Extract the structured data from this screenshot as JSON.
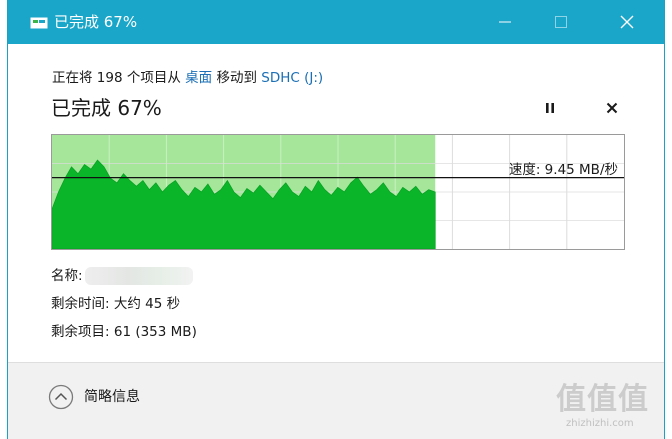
{
  "window": {
    "title": "已完成 67%",
    "accent_color": "#1aa6c9"
  },
  "transfer": {
    "line_prefix": "正在将 198 个项目从 ",
    "source": "桌面",
    "line_mid": " 移动到 ",
    "destination": "SDHC (J:)",
    "status": "已完成 67%",
    "progress_percent": 67,
    "speed_text": "速度: 9.45 MB/秒"
  },
  "details": {
    "name_label": "名称:",
    "time_label": "剩余时间:",
    "time_value": "大约 45 秒",
    "items_label": "剩余项目:",
    "items_value": "61 (353 MB)"
  },
  "footer": {
    "toggle_label": "简略信息"
  },
  "watermark": {
    "text": "值值值",
    "url": "zhizhizhi.com"
  },
  "icons": {
    "app": "transfer-icon",
    "minimize": "minimize-icon",
    "maximize": "maximize-icon",
    "close": "close-icon",
    "pause": "pause-icon",
    "cancel": "cancel-icon",
    "collapse": "chevron-up-icon"
  },
  "chart_data": {
    "type": "area",
    "progress_fraction": 0.67,
    "current_speed_mb_s": 9.45,
    "speed_series": [
      0.35,
      0.5,
      0.62,
      0.72,
      0.66,
      0.74,
      0.7,
      0.78,
      0.72,
      0.62,
      0.58,
      0.66,
      0.6,
      0.55,
      0.6,
      0.52,
      0.58,
      0.5,
      0.56,
      0.6,
      0.52,
      0.46,
      0.54,
      0.5,
      0.57,
      0.48,
      0.52,
      0.6,
      0.5,
      0.45,
      0.53,
      0.49,
      0.56,
      0.5,
      0.44,
      0.52,
      0.58,
      0.5,
      0.46,
      0.55,
      0.5,
      0.6,
      0.52,
      0.47,
      0.54,
      0.5,
      0.58,
      0.63,
      0.55,
      0.48,
      0.52,
      0.58,
      0.5,
      0.46,
      0.54,
      0.5,
      0.55,
      0.48,
      0.52,
      0.5
    ],
    "series_color": "#0bb52a",
    "progress_fill_color": "#a6e69b",
    "grid": true
  }
}
